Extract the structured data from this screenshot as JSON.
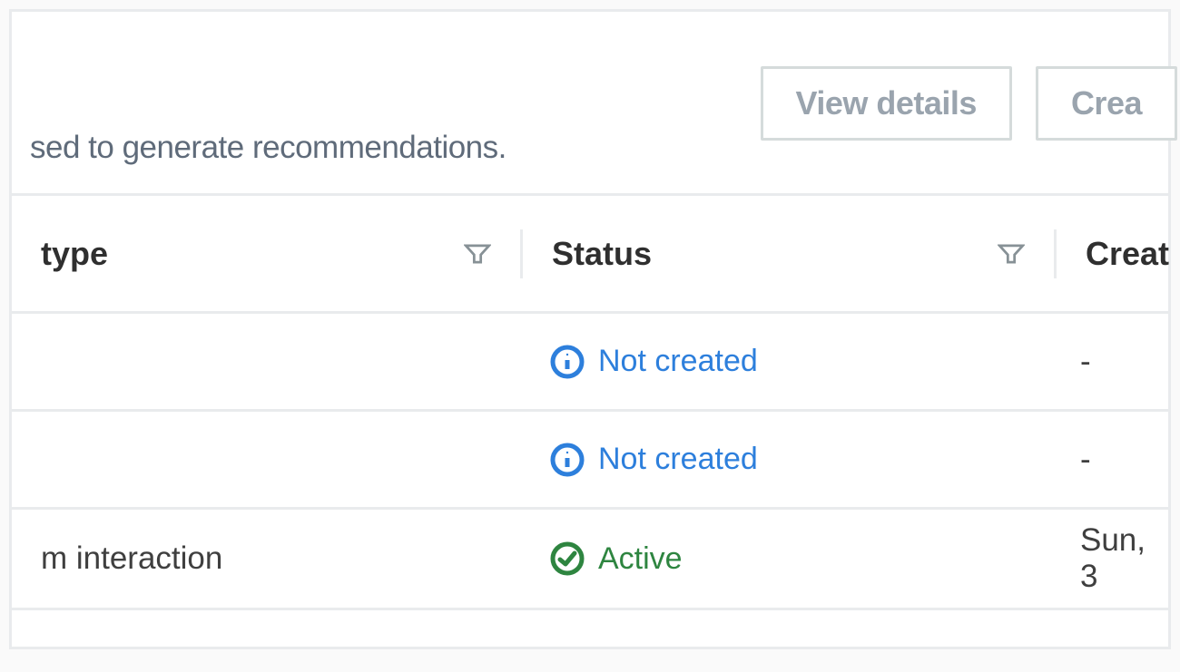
{
  "header": {
    "description": "sed to generate recommendations.",
    "buttons": {
      "view_details": "View details",
      "create": "Crea"
    }
  },
  "table": {
    "columns": {
      "type": "type",
      "status": "Status",
      "created": "Creat"
    },
    "rows": [
      {
        "type": "",
        "status_kind": "info",
        "status_label": "Not created",
        "created": "-"
      },
      {
        "type": "",
        "status_kind": "info",
        "status_label": "Not created",
        "created": "-"
      },
      {
        "type": "m interaction",
        "status_kind": "ok",
        "status_label": "Active",
        "created": "Sun, 3"
      }
    ]
  }
}
